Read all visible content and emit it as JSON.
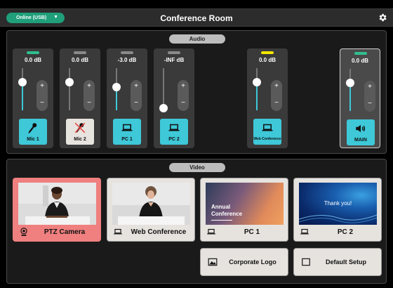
{
  "header": {
    "status_label": "Online (USB)",
    "title": "Conference Room",
    "settings_icon": "gear-icon"
  },
  "audio": {
    "section_label": "Audio",
    "channels": [
      {
        "db": "0.0 dB",
        "label": "Mic 1",
        "icon": "microphone-icon",
        "led_color": "#2fbf8f",
        "level": 0.75,
        "muted": false
      },
      {
        "db": "0.0 dB",
        "label": "Mic 2",
        "icon": "microphone-muted-icon",
        "led_color": "#8a8a8a",
        "level": 0.75,
        "muted": true
      },
      {
        "db": "-3.0 dB",
        "label": "PC 1",
        "icon": "laptop-icon",
        "led_color": "#8a8a8a",
        "level": 0.6,
        "muted": false
      },
      {
        "db": "-INF dB",
        "label": "PC 2",
        "icon": "laptop-icon",
        "led_color": "#8a8a8a",
        "level": 0.0,
        "muted": false
      },
      {
        "db": "0.0 dB",
        "label": "Web Conference",
        "icon": "laptop-icon",
        "led_color": "#f2e600",
        "level": 0.75,
        "muted": false
      },
      {
        "db": "0.0 dB",
        "label": "MAIN",
        "icon": "speaker-icon",
        "led_color": "#2fbf8f",
        "level": 0.75,
        "muted": false
      }
    ],
    "plus_symbol": "+",
    "minus_symbol": "−"
  },
  "video": {
    "section_label": "Video",
    "sources": [
      {
        "label": "PTZ Camera",
        "icon": "webcam-icon",
        "active": true
      },
      {
        "label": "Web Conference",
        "icon": "laptop-icon",
        "active": false
      },
      {
        "label": "PC 1",
        "icon": "laptop-icon",
        "active": false,
        "slide_text": "Annual Conference"
      },
      {
        "label": "PC 2",
        "icon": "laptop-icon",
        "active": false,
        "slide_text": "Thank you!"
      }
    ],
    "buttons": [
      {
        "label": "Corporate Logo",
        "icon": "image-icon"
      },
      {
        "label": "Default Setup",
        "icon": "square-icon"
      }
    ]
  },
  "colors": {
    "accent": "#3ec8d8",
    "active_source": "#f07f7f",
    "status_green": "#1f9f7a"
  }
}
